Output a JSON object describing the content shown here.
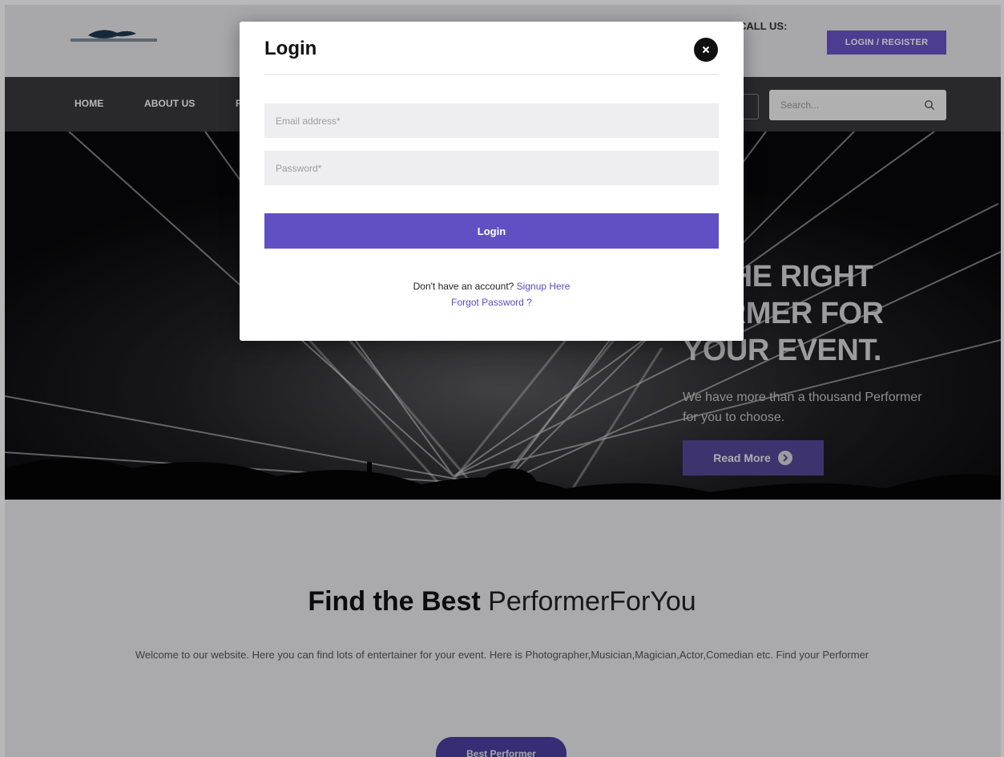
{
  "header": {
    "call_label": "CALL US:",
    "login_register": "LOGIN / REGISTER"
  },
  "nav": {
    "items": [
      "HOME",
      "ABOUT US",
      "P"
    ],
    "search_placeholder": "Search..."
  },
  "hero": {
    "heading_lines": [
      "D THE RIGHT",
      "FORMER FOR",
      "YOUR EVENT."
    ],
    "subtext": "We have more than a thousand Performer for you to choose.",
    "read_more": "Read More"
  },
  "content": {
    "title_bold": "Find the Best",
    "title_light": "PerformerForYou",
    "welcome": "Welcome to our website. Here you can find lots of entertainer for your event. Here is Photographer,Musician,Magician,Actor,Comedian etc. Find your Performer",
    "best_performer": "Best Performer"
  },
  "modal": {
    "title": "Login",
    "email_placeholder": "Email address*",
    "password_placeholder": "Password*",
    "login_button": "Login",
    "signup_prompt": "Don't have an account?",
    "signup_link": "Signup Here",
    "forgot_link": "Forgot Password ?"
  },
  "colors": {
    "accent": "#6150c4",
    "nav_bg": "#3a3a3d",
    "hero_bg": "#0c0c0f"
  },
  "icons": [
    "logo-icon",
    "search-icon",
    "arrow-circle-icon",
    "close-icon"
  ]
}
